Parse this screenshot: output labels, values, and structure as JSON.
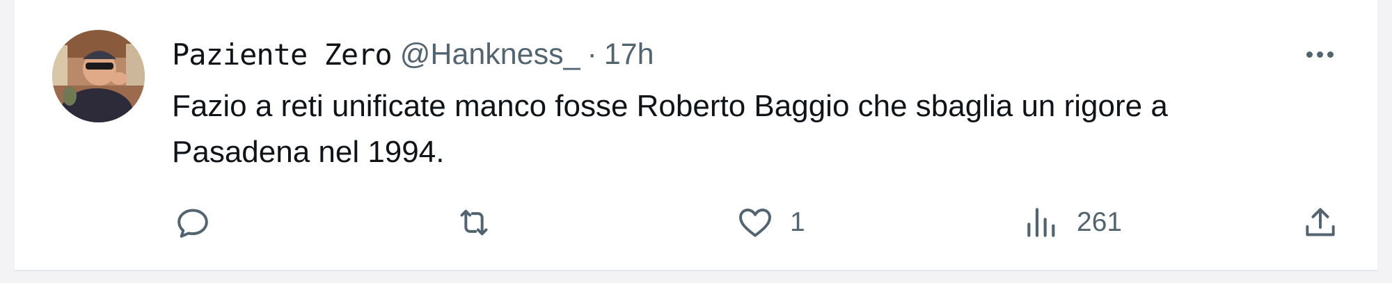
{
  "tweet": {
    "display_name": "Paziente Zero",
    "handle": "@Hankness_",
    "separator": "·",
    "time": "17h",
    "text": "Fazio a reti unificate manco fosse Roberto Baggio che sbaglia un rigore a Pasadena nel 1994.",
    "actions": {
      "reply": {
        "icon": "reply-icon"
      },
      "retweet": {
        "icon": "retweet-icon"
      },
      "like": {
        "icon": "heart-icon",
        "count": "1"
      },
      "views": {
        "icon": "views-chart-icon",
        "count": "261"
      },
      "share": {
        "icon": "share-upload-icon"
      }
    }
  },
  "colors": {
    "text_primary": "#0f1419",
    "text_secondary": "#536471",
    "background": "#ffffff"
  }
}
